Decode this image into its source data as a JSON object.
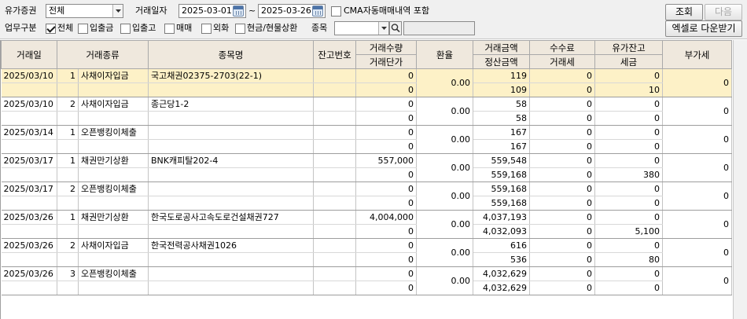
{
  "filters": {
    "securities_label": "유가증권",
    "securities_value": "전체",
    "date_label": "거래일자",
    "date_from": "2025-03-01",
    "date_sep": "~",
    "date_to": "2025-03-26",
    "cma_label": "CMA자동매매내역 포함",
    "cma_checked": false,
    "biz_label": "업무구분",
    "biz_options": [
      {
        "label": "전체",
        "checked": true
      },
      {
        "label": "입출금",
        "checked": false
      },
      {
        "label": "입출고",
        "checked": false
      },
      {
        "label": "매매",
        "checked": false
      },
      {
        "label": "외화",
        "checked": false
      },
      {
        "label": "현금/현물상환",
        "checked": false
      }
    ],
    "stock_label": "종목",
    "stock_value": "",
    "stock_name_value": ""
  },
  "buttons": {
    "search": "조회",
    "next": "다음",
    "excel": "엑셀로 다운받기"
  },
  "columns": {
    "date": "거래일",
    "type": "거래종류",
    "name": "종목명",
    "balance_no": "잔고번호",
    "qty": "거래수량",
    "unit_price": "거래단가",
    "fx": "환율",
    "amount": "거래금액",
    "settle": "정산금액",
    "fee": "수수료",
    "tax": "거래세",
    "sec_balance": "유가잔고",
    "income_tax": "세금",
    "vat": "부가세"
  },
  "rows": [
    {
      "date": "2025/03/10",
      "seq": "1",
      "type": "사채이자입금",
      "name": "국고채권02375-2703(22-1)",
      "balance_no": "",
      "qty": "0",
      "unit_price": "0",
      "fx": "0.00",
      "amount": "119",
      "settle": "109",
      "fee": "0",
      "tax": "0",
      "sec_balance": "0",
      "income_tax": "10",
      "vat": "0",
      "selected": true
    },
    {
      "date": "2025/03/10",
      "seq": "2",
      "type": "사채이자입금",
      "name": "종근당1-2",
      "balance_no": "",
      "qty": "0",
      "unit_price": "0",
      "fx": "0.00",
      "amount": "58",
      "settle": "58",
      "fee": "0",
      "tax": "0",
      "sec_balance": "0",
      "income_tax": "0",
      "vat": "0",
      "selected": false
    },
    {
      "date": "2025/03/14",
      "seq": "1",
      "type": "오픈뱅킹이체출",
      "name": "",
      "balance_no": "",
      "qty": "0",
      "unit_price": "0",
      "fx": "0.00",
      "amount": "167",
      "settle": "167",
      "fee": "0",
      "tax": "0",
      "sec_balance": "0",
      "income_tax": "0",
      "vat": "0",
      "selected": false
    },
    {
      "date": "2025/03/17",
      "seq": "1",
      "type": "채권만기상환",
      "name": "BNK캐피탈202-4",
      "balance_no": "",
      "qty": "557,000",
      "unit_price": "0",
      "fx": "0.00",
      "amount": "559,548",
      "settle": "559,168",
      "fee": "0",
      "tax": "0",
      "sec_balance": "0",
      "income_tax": "380",
      "vat": "0",
      "selected": false
    },
    {
      "date": "2025/03/17",
      "seq": "2",
      "type": "오픈뱅킹이체출",
      "name": "",
      "balance_no": "",
      "qty": "0",
      "unit_price": "0",
      "fx": "0.00",
      "amount": "559,168",
      "settle": "559,168",
      "fee": "0",
      "tax": "0",
      "sec_balance": "0",
      "income_tax": "0",
      "vat": "0",
      "selected": false
    },
    {
      "date": "2025/03/26",
      "seq": "1",
      "type": "채권만기상환",
      "name": "한국도로공사고속도로건설채권727",
      "balance_no": "",
      "qty": "4,004,000",
      "unit_price": "0",
      "fx": "0.00",
      "amount": "4,037,193",
      "settle": "4,032,093",
      "fee": "0",
      "tax": "0",
      "sec_balance": "0",
      "income_tax": "5,100",
      "vat": "0",
      "selected": false
    },
    {
      "date": "2025/03/26",
      "seq": "2",
      "type": "사채이자입금",
      "name": "한국전력공사채권1026",
      "balance_no": "",
      "qty": "0",
      "unit_price": "0",
      "fx": "0.00",
      "amount": "616",
      "settle": "536",
      "fee": "0",
      "tax": "0",
      "sec_balance": "0",
      "income_tax": "80",
      "vat": "0",
      "selected": false
    },
    {
      "date": "2025/03/26",
      "seq": "3",
      "type": "오픈뱅킹이체출",
      "name": "",
      "balance_no": "",
      "qty": "0",
      "unit_price": "0",
      "fx": "0.00",
      "amount": "4,032,629",
      "settle": "4,032,629",
      "fee": "0",
      "tax": "0",
      "sec_balance": "0",
      "income_tax": "0",
      "vat": "0",
      "selected": false
    }
  ]
}
